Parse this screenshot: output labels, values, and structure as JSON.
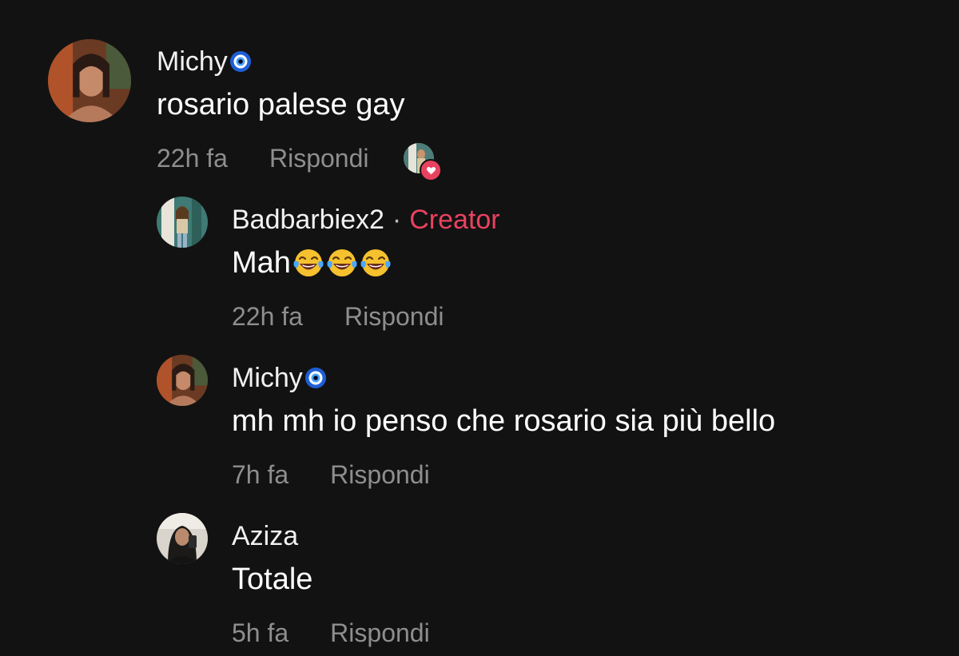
{
  "comments": [
    {
      "username": "Michy",
      "badge_icon": "nazar-eye-icon",
      "text": "rosario palese gay",
      "time": "22h fa",
      "reply_label": "Rispondi",
      "creator_liked": true
    },
    {
      "username": "Badbarbiex2",
      "separator": "·",
      "role": "Creator",
      "text": "Mah",
      "emoji_icons": [
        "face-with-tears-of-joy-icon",
        "face-with-tears-of-joy-icon",
        "face-with-tears-of-joy-icon"
      ],
      "time": "22h fa",
      "reply_label": "Rispondi"
    },
    {
      "username": "Michy",
      "badge_icon": "nazar-eye-icon",
      "text": "mh mh io penso che rosario sia più bello",
      "time": "7h fa",
      "reply_label": "Rispondi"
    },
    {
      "username": "Aziza",
      "text": "Totale",
      "time": "5h fa",
      "reply_label": "Rispondi"
    }
  ],
  "colors": {
    "background": "#121212",
    "creator_accent": "#e94260",
    "meta_text": "#8e8e8e"
  }
}
